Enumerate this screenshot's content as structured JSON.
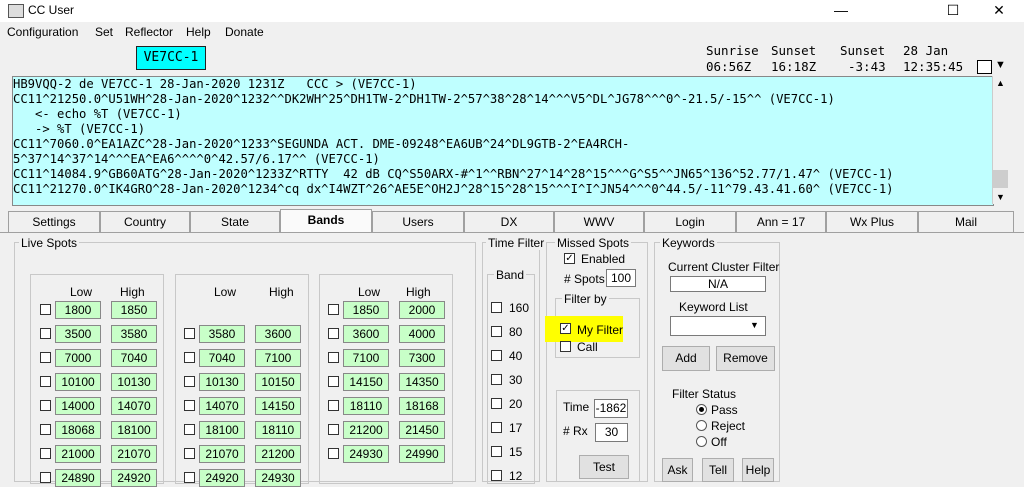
{
  "window": {
    "title": "CC User",
    "minimize": "—",
    "maximize": "☐",
    "close": "✕"
  },
  "menu": [
    "Configuration",
    "Set",
    "Reflector",
    "Help",
    "Donate"
  ],
  "callsign": "VE7CC-1",
  "sun": {
    "sunrise_label": "Sunrise",
    "sunrise": "06:56Z",
    "sunset_label": "Sunset",
    "sunset": "16:18Z",
    "sunset2_label": "Sunset",
    "sunset2": "-3:43",
    "date": "28 Jan",
    "time": "12:35:45"
  },
  "terminal": [
    "HB9VQQ-2 de VE7CC-1 28-Jan-2020 1231Z   CCC > (VE7CC-1)",
    "CC11^21250.0^U51WH^28-Jan-2020^1232^^DK2WH^25^DH1TW-2^DH1TW-2^57^38^28^14^^^V5^DL^JG78^^^0^-21.5/-15^^ (VE7CC-1)",
    "   <- echo %T (VE7CC-1)",
    "   -> %T (VE7CC-1)",
    "CC11^7060.0^EA1AZC^28-Jan-2020^1233^SEGUNDA ACT. DME-09248^EA6UB^24^DL9GTB-2^EA4RCH-",
    "5^37^14^37^14^^^EA^EA6^^^^0^42.57/6.17^^ (VE7CC-1)",
    "CC11^14084.9^GB60ATG^28-Jan-2020^1233Z^RTTY  42 dB CQ^S50ARX-#^1^^RBN^27^14^28^15^^^G^S5^^JN65^136^52.77/1.47^ (VE7CC-1)",
    "CC11^21270.0^IK4GRO^28-Jan-2020^1234^cq dx^I4WZT^26^AE5E^OH2J^28^15^28^15^^^I^I^JN54^^^0^44.5/-11^79.43.41.60^ (VE7CC-1)"
  ],
  "tabs": [
    "Settings",
    "Country",
    "State",
    "Bands",
    "Users",
    "DX",
    "WWV",
    "Login",
    "Ann = 17",
    "Wx Plus",
    "Mail"
  ],
  "active_tab": "Bands",
  "live_spots": {
    "title": "Live Spots",
    "low_label": "Low",
    "high_label": "High",
    "col1": [
      [
        "1800",
        "1850"
      ],
      [
        "3500",
        "3580"
      ],
      [
        "7000",
        "7040"
      ],
      [
        "10100",
        "10130"
      ],
      [
        "14000",
        "14070"
      ],
      [
        "18068",
        "18100"
      ],
      [
        "21000",
        "21070"
      ],
      [
        "24890",
        "24920"
      ]
    ],
    "col2": [
      [
        "3580",
        "3600"
      ],
      [
        "7040",
        "7100"
      ],
      [
        "10130",
        "10150"
      ],
      [
        "14070",
        "14150"
      ],
      [
        "18100",
        "18110"
      ],
      [
        "21070",
        "21200"
      ],
      [
        "24920",
        "24930"
      ]
    ],
    "col3": [
      [
        "1850",
        "2000"
      ],
      [
        "3600",
        "4000"
      ],
      [
        "7100",
        "7300"
      ],
      [
        "14150",
        "14350"
      ],
      [
        "18110",
        "18168"
      ],
      [
        "21200",
        "21450"
      ],
      [
        "24930",
        "24990"
      ]
    ]
  },
  "time_filter": {
    "title": "Time Filter",
    "band_label": "Band",
    "bands": [
      "160",
      "80",
      "40",
      "30",
      "20",
      "17",
      "15",
      "12"
    ]
  },
  "missed_spots": {
    "title": "Missed Spots",
    "enabled_label": "Enabled",
    "spots_label": "# Spots",
    "spots_value": "100",
    "filter_by_label": "Filter by",
    "my_filter_label": "My Filter",
    "call_label": "Call",
    "time_label": "Time",
    "time_value": "-1862",
    "rx_label": "# Rx",
    "rx_value": "30",
    "test_label": "Test"
  },
  "keywords": {
    "title": "Keywords",
    "current_filter_label": "Current Cluster Filter",
    "current_filter_value": "N/A",
    "keyword_list_label": "Keyword List",
    "add_label": "Add",
    "remove_label": "Remove",
    "filter_status_label": "Filter Status",
    "pass_label": "Pass",
    "reject_label": "Reject",
    "off_label": "Off",
    "ask_label": "Ask",
    "tell_label": "Tell",
    "help_label": "Help"
  },
  "colors": {
    "terminal_bg": "#bfffff",
    "callsign_bg": "#00ffff",
    "band_cell": "#c8ffc8",
    "highlight": "#ffff00"
  }
}
